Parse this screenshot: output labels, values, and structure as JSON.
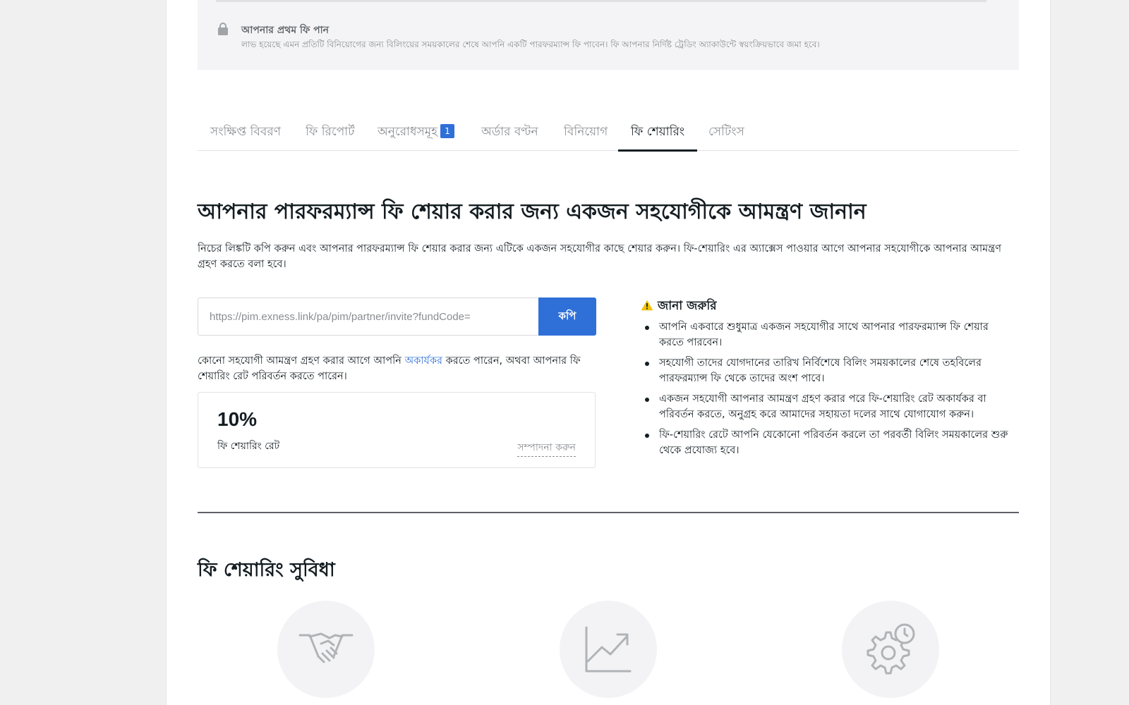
{
  "banner": {
    "title": "আপনার প্রথম ফি পান",
    "text": "লাভ হয়েছে এমন প্রতিটি বিনিয়োগের জন্য বিলিংয়ের সময়কালের শেষে আপনি একটি পারফরম্যান্স ফি পাবেন। ফি আপনার নির্দিষ্ট ট্রেডিং অ্যাকাউন্টে স্বয়ংক্রিয়ভাবে জমা হবে।"
  },
  "tabs": [
    {
      "label": "সংক্ষিপ্ত বিবরণ"
    },
    {
      "label": "ফি রিপোর্ট"
    },
    {
      "label": "অনুরোধসমূহ",
      "badge": "1"
    },
    {
      "label": "অর্ডার বণ্টন"
    },
    {
      "label": "বিনিয়োগ"
    },
    {
      "label": "ফি শেয়ারিং",
      "active": true
    },
    {
      "label": "সেটিংস"
    }
  ],
  "main": {
    "heading": "আপনার পারফরম্যান্স ফি শেয়ার করার জন্য একজন সহযোগীকে আমন্ত্রণ জানান",
    "lead": "নিচের লিঙ্কটি কপি করুন এবং আপনার পারফরম্যান্স ফি শেয়ার করার জন্য এটিকে একজন সহযোগীর কাছে শেয়ার করুন। ফি-শেয়ারিং এর অ্যাক্সেস পাওয়ার আগে আপনার সহযোগীকে আপনার আমন্ত্রণ গ্রহণ করতে বলা হবে।",
    "invite_link": "https://pim.exness.link/pa/pim/partner/invite?fundCode=",
    "copy_label": "কপি",
    "note_before": "কোনো সহযোগী আমন্ত্রণ গ্রহণ করার আগে আপনি ",
    "note_link": "অকার্যকর",
    "note_after": " করতে পারেন, অথবা আপনার ফি শেয়ারিং রেট পরিবর্তন করতে পারেন।",
    "rate_value": "10%",
    "rate_label": "ফি শেয়ারিং রেট",
    "edit_label": "সম্পাদনা করুন"
  },
  "important": {
    "title": "জানা জরুরি",
    "items": [
      "আপনি একবারে শুধুমাত্র একজন সহযোগীর সাথে আপনার পারফরম্যান্স ফি শেয়ার করতে পারবেন।",
      "সহযোগী তাদের যোগদানের তারিখ নির্বিশেষে বিলিং সময়কালের শেষে তহবিলের পারফরম্যান্স ফি থেকে তাদের অংশ পাবে।",
      "একজন সহযোগী আপনার আমন্ত্রণ গ্রহণ করার পরে ফি-শেয়ারিং রেট অকার্যকর বা পরিবর্তন করতে, অনুগ্রহ করে আমাদের সহায়তা দলের সাথে যোগাযোগ করুন।",
      "ফি-শেয়ারিং রেটে আপনি যেকোনো পরিবর্তন করলে তা পরবর্তী বিলিং সময়কালের শুরু থেকে প্রযোজ্য হবে।"
    ]
  },
  "benefits": {
    "heading": "ফি শেয়ারিং সুবিধা",
    "icons": [
      "handshake-icon",
      "chart-growth-icon",
      "gear-clock-icon"
    ]
  },
  "colors": {
    "accent": "#2f6fd8",
    "text": "#141d22",
    "muted": "#8a8d91",
    "warning": "#f2c200"
  }
}
